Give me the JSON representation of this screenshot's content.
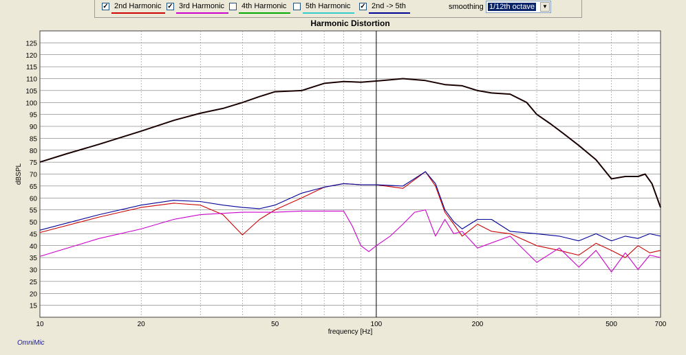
{
  "toolbar": {
    "harmonics": [
      {
        "label": "2nd Harmonic",
        "checked": true,
        "color": "#cc0000"
      },
      {
        "label": "3rd Harmonic",
        "checked": true,
        "color": "#cc00cc"
      },
      {
        "label": "4th Harmonic",
        "checked": false,
        "color": "#00aa00"
      },
      {
        "label": "5th Harmonic",
        "checked": false,
        "color": "#33cccc"
      },
      {
        "label": "2nd -> 5th",
        "checked": true,
        "color": "#000099"
      }
    ],
    "check_mark": "✓",
    "smoothing_label": "smoothing",
    "smoothing_value": "1/12th octave",
    "dropdown_icon": "chevron-down-icon",
    "dropdown_glyph": "▼"
  },
  "brand": "OmniMic",
  "chart_data": {
    "type": "line",
    "title": "Harmonic Distortion",
    "xlabel": "frequency [Hz]",
    "ylabel": "dBSPL",
    "x_scale": "log",
    "xlim": [
      10,
      700
    ],
    "ylim": [
      10,
      130
    ],
    "x_ticks": [
      10,
      20,
      50,
      100,
      200,
      500,
      700
    ],
    "y_ticks": [
      15,
      20,
      25,
      30,
      35,
      40,
      45,
      50,
      55,
      60,
      65,
      70,
      75,
      80,
      85,
      90,
      95,
      100,
      105,
      110,
      115,
      120,
      125
    ],
    "grid": true,
    "cursor_x": 100,
    "series": [
      {
        "color": "#1a0000",
        "points": [
          [
            10,
            75
          ],
          [
            12,
            78.5
          ],
          [
            15,
            82.5
          ],
          [
            20,
            88
          ],
          [
            25,
            92.5
          ],
          [
            30,
            95.5
          ],
          [
            35,
            97.5
          ],
          [
            40,
            100
          ],
          [
            45,
            102.5
          ],
          [
            50,
            104.5
          ],
          [
            60,
            105
          ],
          [
            70,
            108
          ],
          [
            80,
            108.8
          ],
          [
            90,
            108.5
          ],
          [
            100,
            109
          ],
          [
            110,
            109.5
          ],
          [
            120,
            110
          ],
          [
            140,
            109.2
          ],
          [
            160,
            107.5
          ],
          [
            180,
            107
          ],
          [
            200,
            105
          ],
          [
            220,
            104
          ],
          [
            250,
            103.5
          ],
          [
            280,
            100
          ],
          [
            300,
            95
          ],
          [
            330,
            91
          ],
          [
            360,
            87
          ],
          [
            400,
            82
          ],
          [
            450,
            76
          ],
          [
            500,
            68
          ],
          [
            550,
            69
          ],
          [
            600,
            69
          ],
          [
            630,
            70
          ],
          [
            660,
            66
          ],
          [
            700,
            56
          ]
        ]
      },
      {
        "color": "#cc0000",
        "points": [
          [
            10,
            45.5
          ],
          [
            15,
            52
          ],
          [
            20,
            56
          ],
          [
            25,
            57.8
          ],
          [
            30,
            57
          ],
          [
            35,
            53
          ],
          [
            40,
            44.5
          ],
          [
            45,
            51
          ],
          [
            50,
            55
          ],
          [
            60,
            60
          ],
          [
            70,
            64.5
          ],
          [
            80,
            66
          ],
          [
            90,
            65.5
          ],
          [
            100,
            65.5
          ],
          [
            120,
            64
          ],
          [
            140,
            71
          ],
          [
            150,
            65
          ],
          [
            160,
            54
          ],
          [
            170,
            49
          ],
          [
            180,
            44
          ],
          [
            200,
            49
          ],
          [
            220,
            46
          ],
          [
            250,
            45
          ],
          [
            300,
            40
          ],
          [
            350,
            38
          ],
          [
            400,
            36
          ],
          [
            450,
            41
          ],
          [
            500,
            38
          ],
          [
            550,
            35
          ],
          [
            600,
            40
          ],
          [
            650,
            37
          ],
          [
            700,
            38
          ]
        ]
      },
      {
        "color": "#cc00cc",
        "points": [
          [
            10,
            35.5
          ],
          [
            15,
            43
          ],
          [
            20,
            47
          ],
          [
            25,
            51
          ],
          [
            30,
            53
          ],
          [
            40,
            54
          ],
          [
            50,
            54
          ],
          [
            60,
            54.5
          ],
          [
            70,
            54.5
          ],
          [
            80,
            54.5
          ],
          [
            85,
            48
          ],
          [
            90,
            40
          ],
          [
            95,
            37.5
          ],
          [
            100,
            40
          ],
          [
            110,
            44
          ],
          [
            120,
            49
          ],
          [
            130,
            54
          ],
          [
            140,
            55
          ],
          [
            150,
            44
          ],
          [
            160,
            51
          ],
          [
            170,
            45
          ],
          [
            180,
            46
          ],
          [
            200,
            39
          ],
          [
            250,
            44
          ],
          [
            300,
            33
          ],
          [
            350,
            39
          ],
          [
            400,
            31
          ],
          [
            450,
            38
          ],
          [
            500,
            29
          ],
          [
            550,
            37
          ],
          [
            600,
            30
          ],
          [
            650,
            36
          ],
          [
            700,
            35
          ]
        ]
      },
      {
        "color": "#000099",
        "points": [
          [
            10,
            46.5
          ],
          [
            15,
            53
          ],
          [
            20,
            57
          ],
          [
            25,
            59
          ],
          [
            30,
            58.5
          ],
          [
            35,
            57
          ],
          [
            40,
            56
          ],
          [
            45,
            55.5
          ],
          [
            50,
            57
          ],
          [
            60,
            62
          ],
          [
            70,
            64.5
          ],
          [
            80,
            66
          ],
          [
            90,
            65.5
          ],
          [
            100,
            65.5
          ],
          [
            120,
            65
          ],
          [
            140,
            71
          ],
          [
            150,
            66
          ],
          [
            160,
            55
          ],
          [
            170,
            50
          ],
          [
            180,
            47
          ],
          [
            200,
            51
          ],
          [
            220,
            51
          ],
          [
            250,
            46
          ],
          [
            300,
            45
          ],
          [
            350,
            44
          ],
          [
            400,
            42
          ],
          [
            450,
            45
          ],
          [
            500,
            42
          ],
          [
            550,
            44
          ],
          [
            600,
            43
          ],
          [
            650,
            45
          ],
          [
            700,
            44
          ]
        ]
      }
    ]
  }
}
